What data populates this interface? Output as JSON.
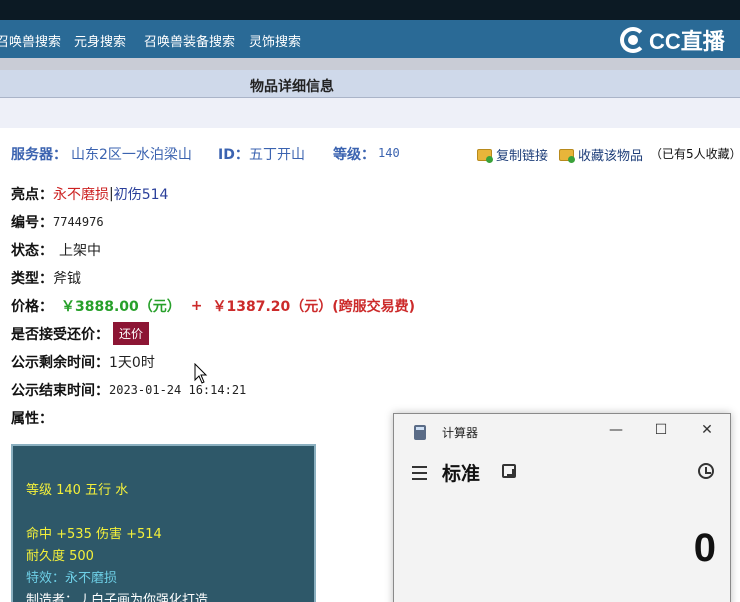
{
  "nav": {
    "items": [
      "召唤兽搜索",
      "元身搜索",
      "召唤兽装备搜索",
      "灵饰搜索"
    ],
    "logo_text": "CC直播"
  },
  "page_title": "物品详细信息",
  "info": {
    "server_label": "服务器：",
    "server_value": "山东2区一水泊梁山",
    "id_label": "ID：",
    "id_value": "五丁开山",
    "level_label": "等级：",
    "level_value": "140",
    "copy_link": "复制链接",
    "favorite": "收藏该物品",
    "favorite_note": "（已有5人收藏）"
  },
  "details": {
    "highlight_label": "亮点：",
    "highlight_red": "永不磨损",
    "highlight_sep": "|",
    "highlight_blue": "初伤514",
    "number_label": "编号：",
    "number_value": "7744976",
    "status_label": "状态：",
    "status_value": "上架中",
    "type_label": "类型：",
    "type_value": "斧钺",
    "price_label": "价格：",
    "price_main": "￥3888.00（元）",
    "price_plus": "+",
    "price_fee": "￥1387.20（元）(跨服交易费)",
    "counter_label": "是否接受还价：",
    "counter_button": "还价",
    "remaining_label": "公示剩余时间：",
    "remaining_value": "1天0时",
    "end_label": "公示结束时间：",
    "end_value": "2023-01-24 16:14:21",
    "attr_label": "属性："
  },
  "attributes": {
    "line1": "等级 140 五行 水",
    "line2": "命中 +535 伤害 +514",
    "line3": "耐久度 500",
    "line4": "特效：永不磨损",
    "line5": "制造者：丿白子画为你强化打造"
  },
  "calculator": {
    "title": "计算器",
    "mode": "标准",
    "display": "0",
    "min_glyph": "—",
    "max_glyph": "☐",
    "close_glyph": "✕"
  },
  "colors": {
    "navbar": "#2a6a96",
    "attr_bg": "#2e5869",
    "counter_button": "#8c1534",
    "price_green": "#27a02a",
    "price_red": "#cc2a2a"
  }
}
